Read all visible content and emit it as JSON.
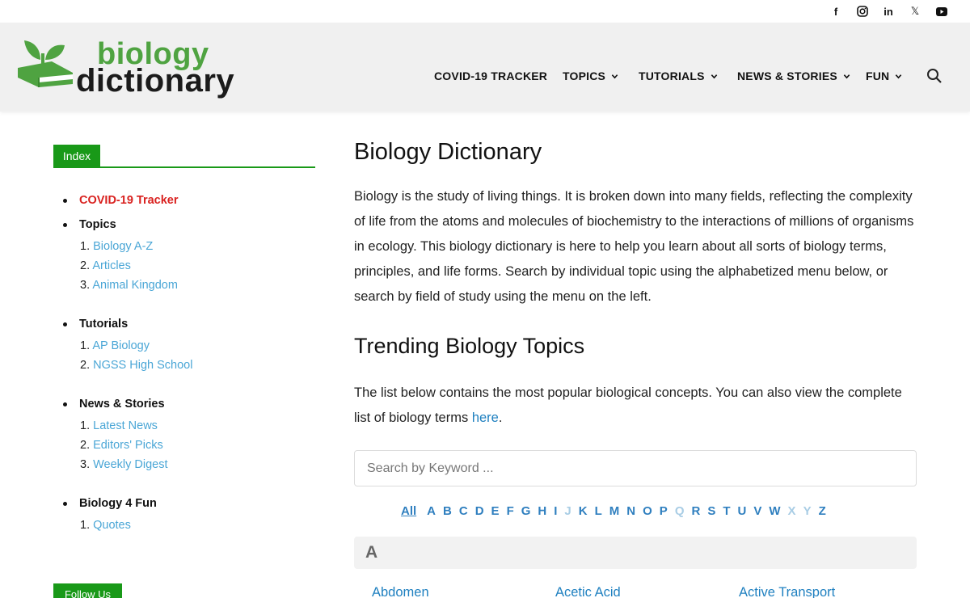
{
  "social": {
    "facebook": "f",
    "instagram": "instagram-icon",
    "linkedin": "in",
    "x": "𝕏",
    "youtube": "youtube-icon"
  },
  "logo": {
    "word1": "biology",
    "word2": "dictionary"
  },
  "nav": {
    "covid": "COVID-19 TRACKER",
    "topics": "TOPICS",
    "tutorials": "TUTORIALS",
    "news": "NEWS & STORIES",
    "fun": "FUN"
  },
  "sidebar": {
    "tab": "Index",
    "covid": "COVID-19 Tracker",
    "topics": {
      "label": "Topics",
      "items": [
        "Biology A-Z",
        "Articles",
        "Animal Kingdom"
      ]
    },
    "tutorials": {
      "label": "Tutorials",
      "items": [
        "AP Biology",
        "NGSS High School"
      ]
    },
    "news": {
      "label": "News & Stories",
      "items": [
        "Latest News",
        "Editors' Picks",
        "Weekly Digest"
      ]
    },
    "fun": {
      "label": "Biology 4 Fun",
      "items": [
        "Quotes"
      ]
    },
    "follow": "Follow Us"
  },
  "main": {
    "title": "Biology Dictionary",
    "intro": "Biology is the study of living things. It is broken down into many fields, reflecting the complexity of life from the atoms and molecules of biochemistry to the interactions of millions of organisms in ecology. This biology dictionary is here to help you learn about all sorts of biology terms, principles, and life forms. Search by individual topic using the alphabetized menu below, or search by field of study using the menu on the left.",
    "trending_title": "Trending Biology Topics",
    "trending_text": "The list below contains the most popular biological concepts. You can also view the complete list of biology terms ",
    "trending_link": "here",
    "trending_end": ".",
    "search_placeholder": "Search by Keyword ...",
    "alphabet": {
      "all": "All",
      "letters": [
        "A",
        "B",
        "C",
        "D",
        "E",
        "F",
        "G",
        "H",
        "I",
        "J",
        "K",
        "L",
        "M",
        "N",
        "O",
        "P",
        "Q",
        "R",
        "S",
        "T",
        "U",
        "V",
        "W",
        "X",
        "Y",
        "Z"
      ],
      "disabled": [
        "J",
        "Q",
        "X",
        "Y"
      ]
    },
    "letter_heading": "A",
    "terms": [
      "Abdomen",
      "Acetic Acid",
      "Active Transport"
    ]
  },
  "colors": {
    "green": "#199918",
    "logo_green": "#4fa341",
    "link": "#1f80c0",
    "side_link": "#4aa6d6",
    "red": "#d9211f"
  }
}
